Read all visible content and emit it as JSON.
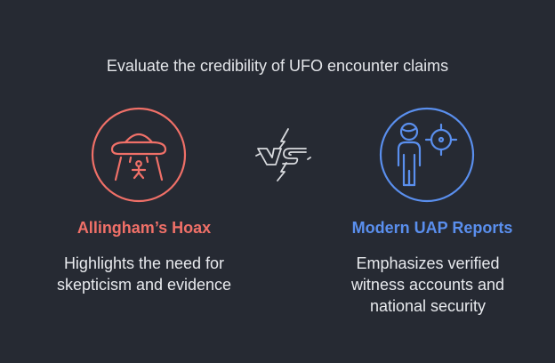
{
  "title": "Evaluate the credibility of UFO encounter claims",
  "left": {
    "heading": "Allingham’s Hoax",
    "description_lines": [
      "Highlights the need for",
      "skepticism and evidence"
    ],
    "icon": "ufo-abduction-icon",
    "color": "#f07068"
  },
  "center": {
    "icon": "vs-icon",
    "color": "#d8dade"
  },
  "right": {
    "heading": "Modern UAP Reports",
    "description_lines": [
      "Emphasizes verified",
      "witness accounts and",
      "national security"
    ],
    "icon": "witness-target-icon",
    "color": "#5a8fee"
  }
}
